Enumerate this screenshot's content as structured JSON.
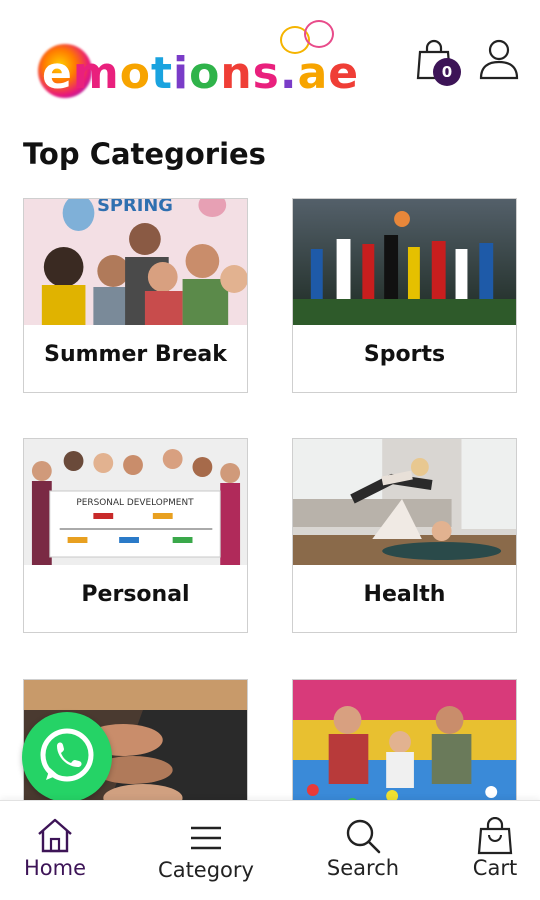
{
  "header": {
    "logo_text": "emotions.ae",
    "cart_count": "0",
    "icons": [
      "cart-icon",
      "user-icon"
    ]
  },
  "section": {
    "title": "Top Categories"
  },
  "categories": [
    {
      "label": "Summer Break",
      "image_text": "SPRING"
    },
    {
      "label": "Sports"
    },
    {
      "label": "Personal",
      "image_text": "PERSONAL DEVELOPMENT"
    },
    {
      "label": "Health"
    },
    {
      "label": ""
    },
    {
      "label": ""
    }
  ],
  "bottom_nav": {
    "items": [
      {
        "label": "Home",
        "icon": "home-icon",
        "active": true
      },
      {
        "label": "Category",
        "icon": "menu-icon"
      },
      {
        "label": "Search",
        "icon": "search-icon"
      },
      {
        "label": "Cart",
        "icon": "bag-icon"
      }
    ]
  },
  "colors": {
    "accent": "#3d1457",
    "whatsapp": "#25d366"
  }
}
